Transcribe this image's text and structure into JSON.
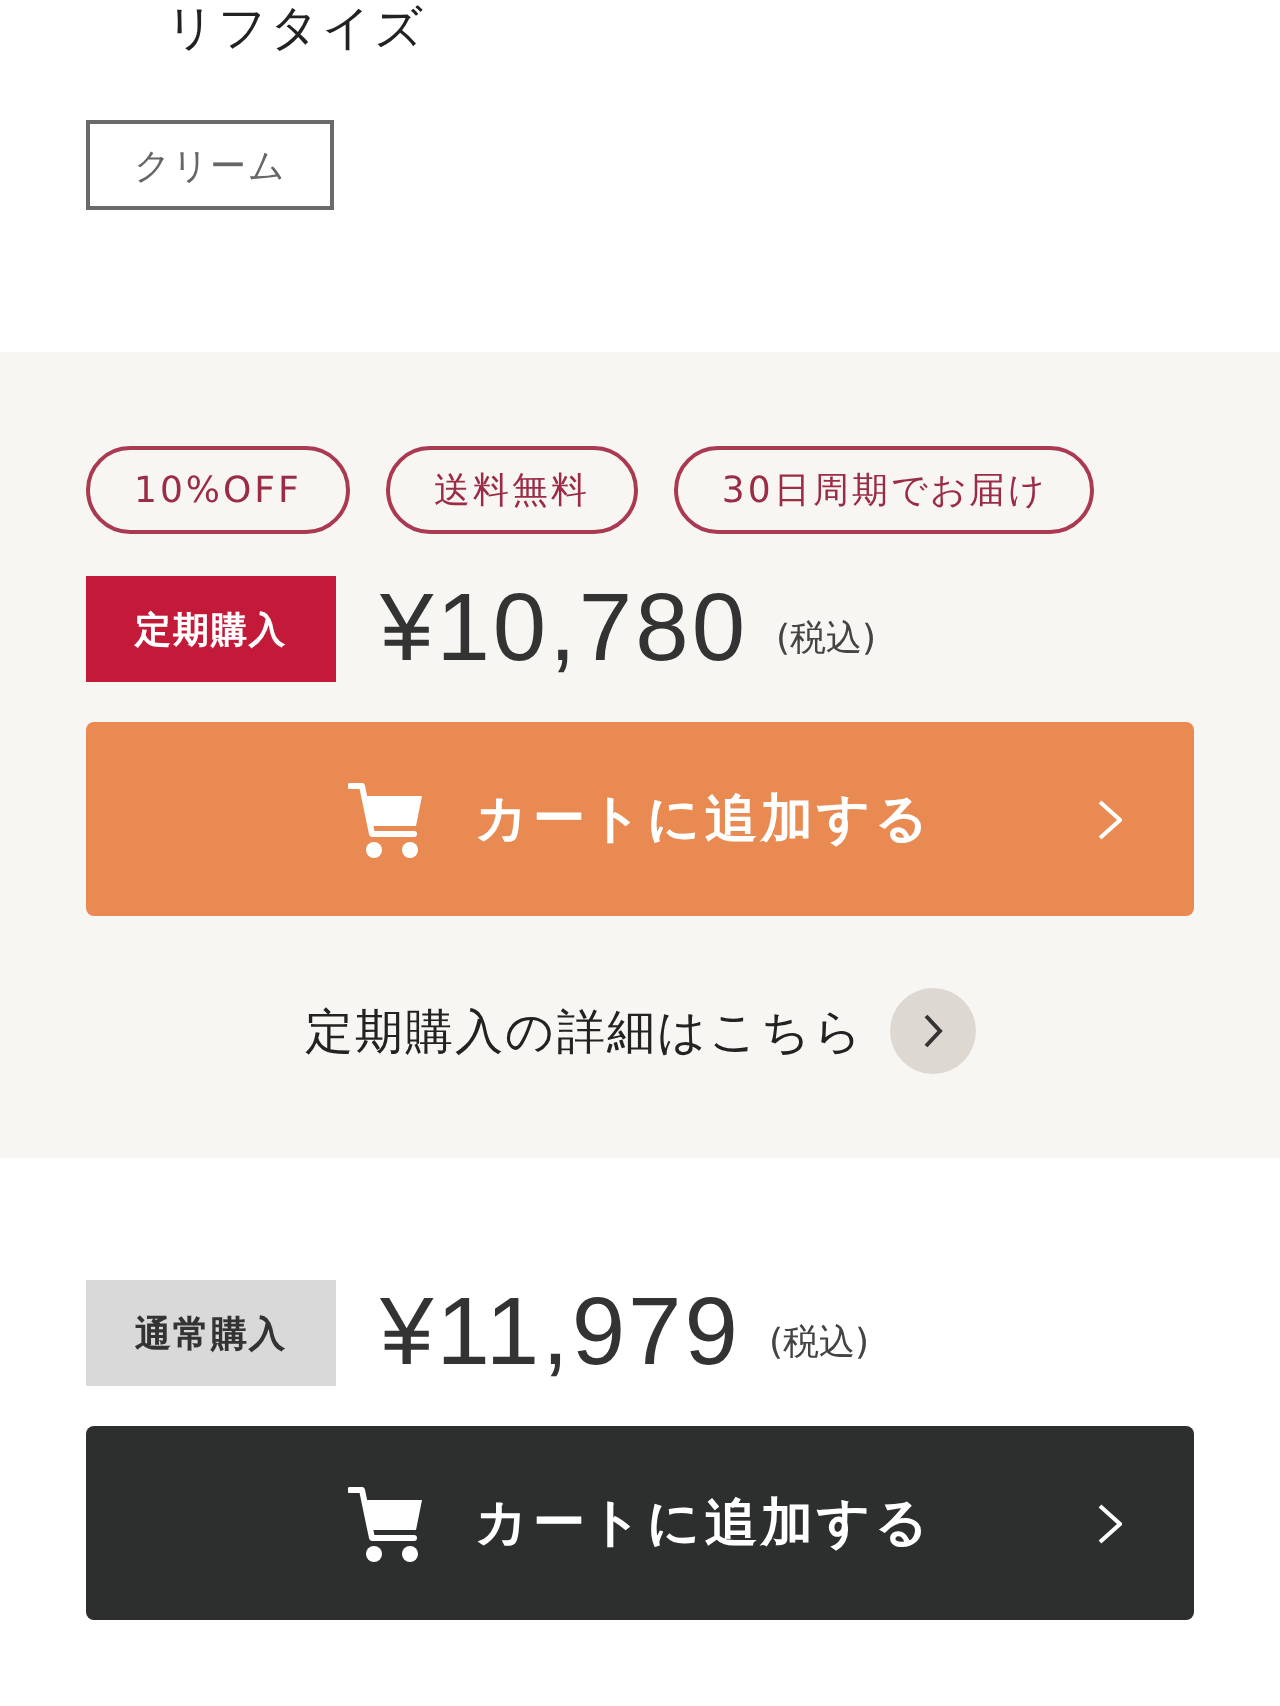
{
  "product": {
    "name": "リフタイズ",
    "variant": "クリーム"
  },
  "purchase_options": [
    {
      "kind": "subscription",
      "tags": [
        "10%OFF",
        "送料無料",
        "30日周期でお届け"
      ],
      "label": "定期購入",
      "price": "¥10,780",
      "tax_note": "(税込)",
      "button": "カートに追加する",
      "details_link": "定期購入の詳細はこちら"
    },
    {
      "kind": "regular",
      "label": "通常購入",
      "price": "¥11,979",
      "tax_note": "(税込)",
      "button": "カートに追加する"
    }
  ]
}
